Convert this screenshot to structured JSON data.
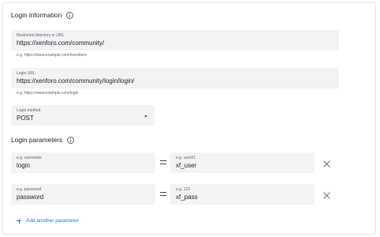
{
  "login_info": {
    "title": "Login information",
    "icon": "info-icon",
    "restricted": {
      "label": "Restricted directory or URL",
      "value": "https://xenforo.com/community/",
      "hint": "e.g. https://www.example.com/members"
    },
    "login_url": {
      "label": "Login URL",
      "value": "https://xenforo.com/community/login/login/",
      "hint": "e.g. https://www.example.com/login"
    },
    "method": {
      "label": "Login method",
      "value": "POST"
    }
  },
  "login_params": {
    "title": "Login parameters",
    "icon": "info-icon",
    "rows": [
      {
        "name_label": "e.g. username",
        "name_value": "login",
        "value_label": "e.g. user01",
        "value_value": "xf_user"
      },
      {
        "name_label": "e.g. password",
        "name_value": "password",
        "value_label": "e.g. 123",
        "value_value": "xf_pass"
      }
    ],
    "add_label": "Add another parameter"
  },
  "colors": {
    "field_bg": "#f1f3f4",
    "link": "#1a73e8",
    "text": "#202124",
    "muted": "#5f6368"
  }
}
